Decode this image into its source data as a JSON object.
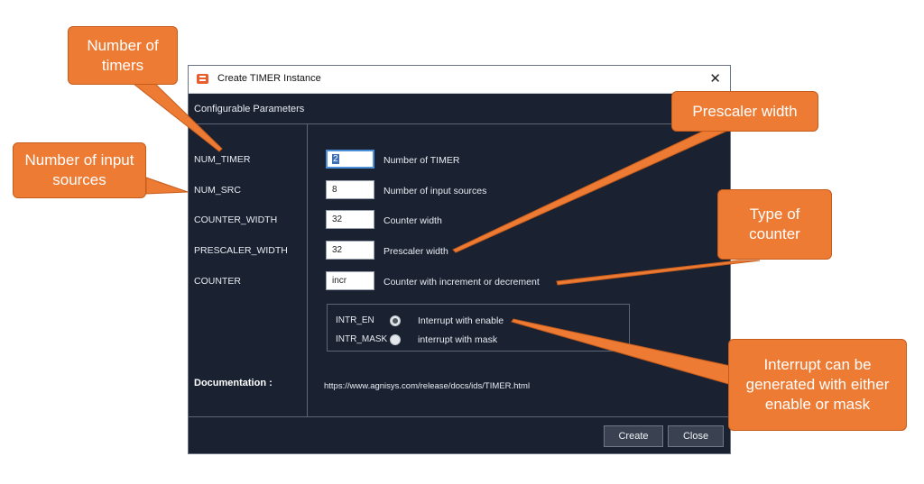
{
  "window": {
    "title": "Create TIMER Instance",
    "close_glyph": "✕",
    "section_header": "Configurable Parameters"
  },
  "params": [
    {
      "name": "NUM_TIMER",
      "value": "2",
      "description": "Number of TIMER",
      "focused": true
    },
    {
      "name": "NUM_SRC",
      "value": "8",
      "description": "Number of input sources"
    },
    {
      "name": "COUNTER_WIDTH",
      "value": "32",
      "description": "Counter width"
    },
    {
      "name": "PRESCALER_WIDTH",
      "value": "32",
      "description": "Prescaler width"
    },
    {
      "name": "COUNTER",
      "value": "incr",
      "description": "Counter with increment or decrement"
    }
  ],
  "radios": [
    {
      "label": "INTR_EN",
      "description": "Interrupt with enable",
      "checked": true
    },
    {
      "label": "INTR_MASK",
      "description": "interrupt with mask",
      "checked": false
    }
  ],
  "documentation": {
    "label": "Documentation :",
    "url": "https://www.agnisys.com/release/docs/ids/TIMER.html"
  },
  "buttons": {
    "create": "Create",
    "close": "Close"
  },
  "callouts": {
    "num_timers": "Number of timers",
    "num_sources": "Number of input sources",
    "prescaler": "Prescaler width",
    "counter_type": "Type of counter",
    "interrupt": "Interrupt can be generated with either enable or mask"
  },
  "colors": {
    "dialog_bg": "#1a2232",
    "callout": "#ee7b33",
    "focus": "#4a90d9"
  },
  "icons": [
    "app-icon",
    "close-icon",
    "radio-checked",
    "radio-unchecked"
  ]
}
